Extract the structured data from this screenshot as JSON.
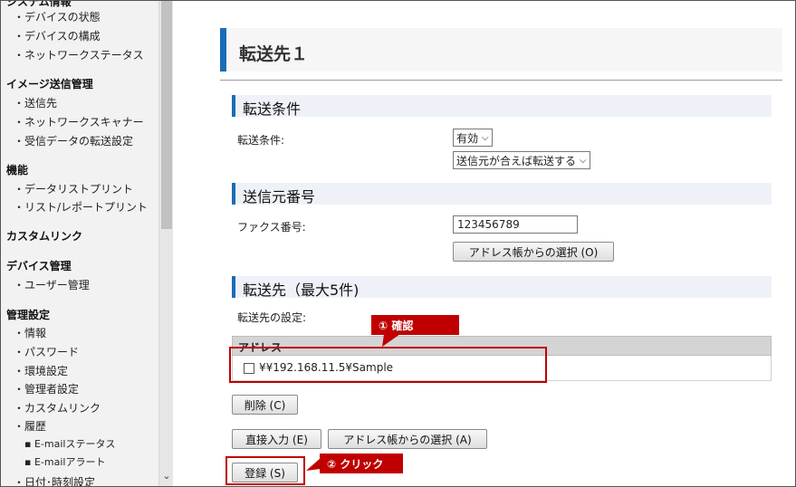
{
  "sidebar": {
    "groups": [
      {
        "title": "システム情報",
        "items": [
          "デバイスの状態",
          "デバイスの構成",
          "ネットワークステータス"
        ]
      },
      {
        "title": "イメージ送信管理",
        "items": [
          "送信先",
          "ネットワークスキャナー",
          "受信データの転送設定"
        ]
      },
      {
        "title": "機能",
        "items": [
          "データリストプリント",
          "リスト/レポートプリント"
        ]
      },
      {
        "title": "カスタムリンク",
        "items": []
      },
      {
        "title": "デバイス管理",
        "items": [
          "ユーザー管理"
        ]
      },
      {
        "title": "管理設定",
        "items": [
          "情報",
          "パスワード",
          "環境設定",
          "管理者設定",
          "カスタムリンク",
          "履歴"
        ],
        "subitems": [
          "E-mailステータス",
          "E-mailアラート"
        ],
        "tail": "日付･時刻設定"
      }
    ],
    "bullet": "・",
    "sub_bullet": "▪"
  },
  "page": {
    "title": "転送先１"
  },
  "transfer_condition": {
    "heading": "転送条件",
    "label": "転送条件:",
    "enable_value": "有効",
    "mode_value": "送信元が合えば転送する"
  },
  "sender_number": {
    "heading": "送信元番号",
    "fax_label": "ファクス番号:",
    "fax_value": "123456789",
    "address_book_button": "アドレス帳からの選択 (O)"
  },
  "destinations": {
    "heading": "転送先（最大5件)",
    "setting_label": "転送先の設定:",
    "table_header": "アドレス",
    "rows": [
      {
        "address": "¥¥192.168.11.5¥Sample",
        "checked": false
      }
    ],
    "delete_button": "削除 (C)",
    "direct_input_button": "直接入力 (E)",
    "address_book_button": "アドレス帳からの選択 (A)",
    "register_button": "登録 (S)"
  },
  "annotations": {
    "confirm": "① 確認",
    "click": "② クリック",
    "color": "#c00000"
  }
}
